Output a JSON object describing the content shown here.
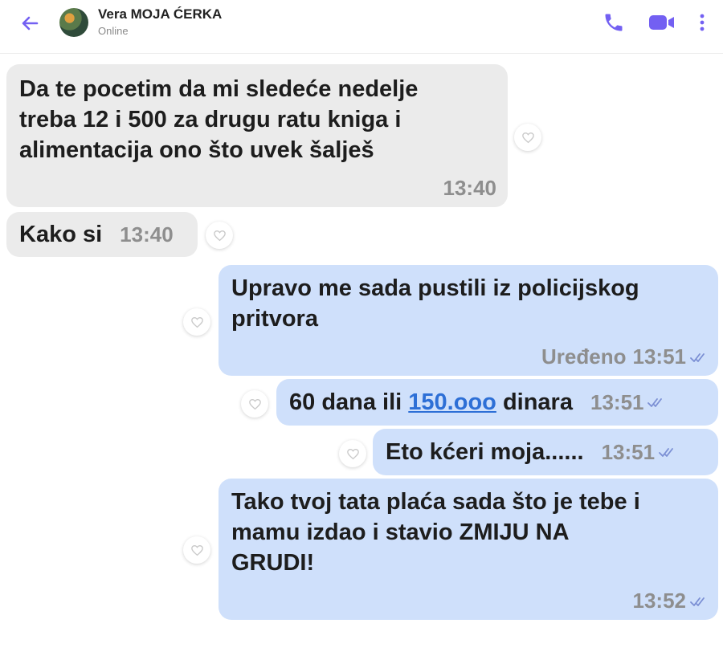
{
  "header": {
    "contact_name": "Vera MOJA ĆERKA",
    "status": "Online"
  },
  "colors": {
    "accent": "#7360f2",
    "incoming_bubble": "#ebebeb",
    "outgoing_bubble": "#cfe0fb",
    "link": "#2d6fd6"
  },
  "icons": {
    "back": "arrow-left-icon",
    "call": "phone-icon",
    "video": "video-camera-icon",
    "more": "more-vertical-icon",
    "like": "heart-icon",
    "delivered": "double-check-icon"
  },
  "messages": [
    {
      "direction": "incoming",
      "lines": [
        "Da te pocetim da mi sledeće nedelje",
        "treba 12 i 500 za drugu ratu kniga i",
        "alimentacija ono što uvek šalješ"
      ],
      "time": "13:40"
    },
    {
      "direction": "incoming",
      "text": "Kako si",
      "time": "13:40"
    },
    {
      "direction": "outgoing",
      "lines": [
        "Upravo me sada pustili iz policijskog",
        "pritvora"
      ],
      "edited": "Uređeno",
      "time": "13:51"
    },
    {
      "direction": "outgoing",
      "text_before": "60 dana ili ",
      "link": "150.ooo",
      "text_after": " dinara",
      "time": "13:51"
    },
    {
      "direction": "outgoing",
      "text": "Eto kćeri moja......",
      "time": "13:51"
    },
    {
      "direction": "outgoing",
      "lines": [
        "Tako tvoj tata plaća sada što je tebe i",
        "mamu izdao i stavio ZMIJU NA",
        "GRUDI!"
      ],
      "time": "13:52"
    }
  ]
}
